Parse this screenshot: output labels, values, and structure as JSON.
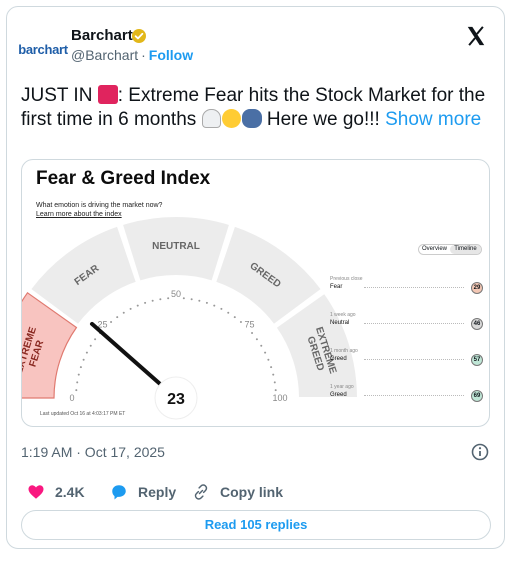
{
  "author": {
    "avatar_text": "barchart",
    "display_name": "Barchart",
    "handle": "@Barchart",
    "separator": "·",
    "follow_label": "Follow"
  },
  "tweet": {
    "text_start": "JUST IN ",
    "text_main": ": Extreme Fear hits the Stock Market for the first time in 6 months ",
    "text_end": " Here we go!!! ",
    "emojis": [
      "siren-emoji",
      "ghost-emoji",
      "screaming-face-emoji",
      "people-hugging-emoji"
    ],
    "show_more_label": "Show more"
  },
  "media": {
    "title": "Fear & Greed Index",
    "question": "What emotion is driving the market now?",
    "learn_more": "Learn more about the index",
    "toggle": [
      "Overview",
      "Timeline"
    ],
    "segments": [
      "EXTREME FEAR",
      "FEAR",
      "NEUTRAL",
      "GREED",
      "EXTREME GREED"
    ],
    "scale": [
      "0",
      "25",
      "50",
      "75",
      "100"
    ],
    "value": 23,
    "value_text": "23",
    "history": [
      {
        "when": "Previous close",
        "label": "Fear",
        "value": "29",
        "color": "#f3c7b4"
      },
      {
        "when": "1 week ago",
        "label": "Neutral",
        "value": "46",
        "color": "#d9d9d9"
      },
      {
        "when": "1 month ago",
        "label": "Greed",
        "value": "57",
        "color": "#bfe6d6"
      },
      {
        "when": "1 year ago",
        "label": "Greed",
        "value": "69",
        "color": "#bfe6d6"
      }
    ],
    "updated": "Last updated Oct 16 at 4:03:17 PM ET"
  },
  "meta": {
    "timestamp": "1:19 AM · Oct 17, 2025"
  },
  "actions": {
    "likes": "2.4K",
    "reply": "Reply",
    "copy_link": "Copy link",
    "read_replies": "Read 105 replies"
  },
  "colors": {
    "accent": "#1d9bf0",
    "like": "#f91880",
    "extreme_fear": "#f8c4c0"
  }
}
